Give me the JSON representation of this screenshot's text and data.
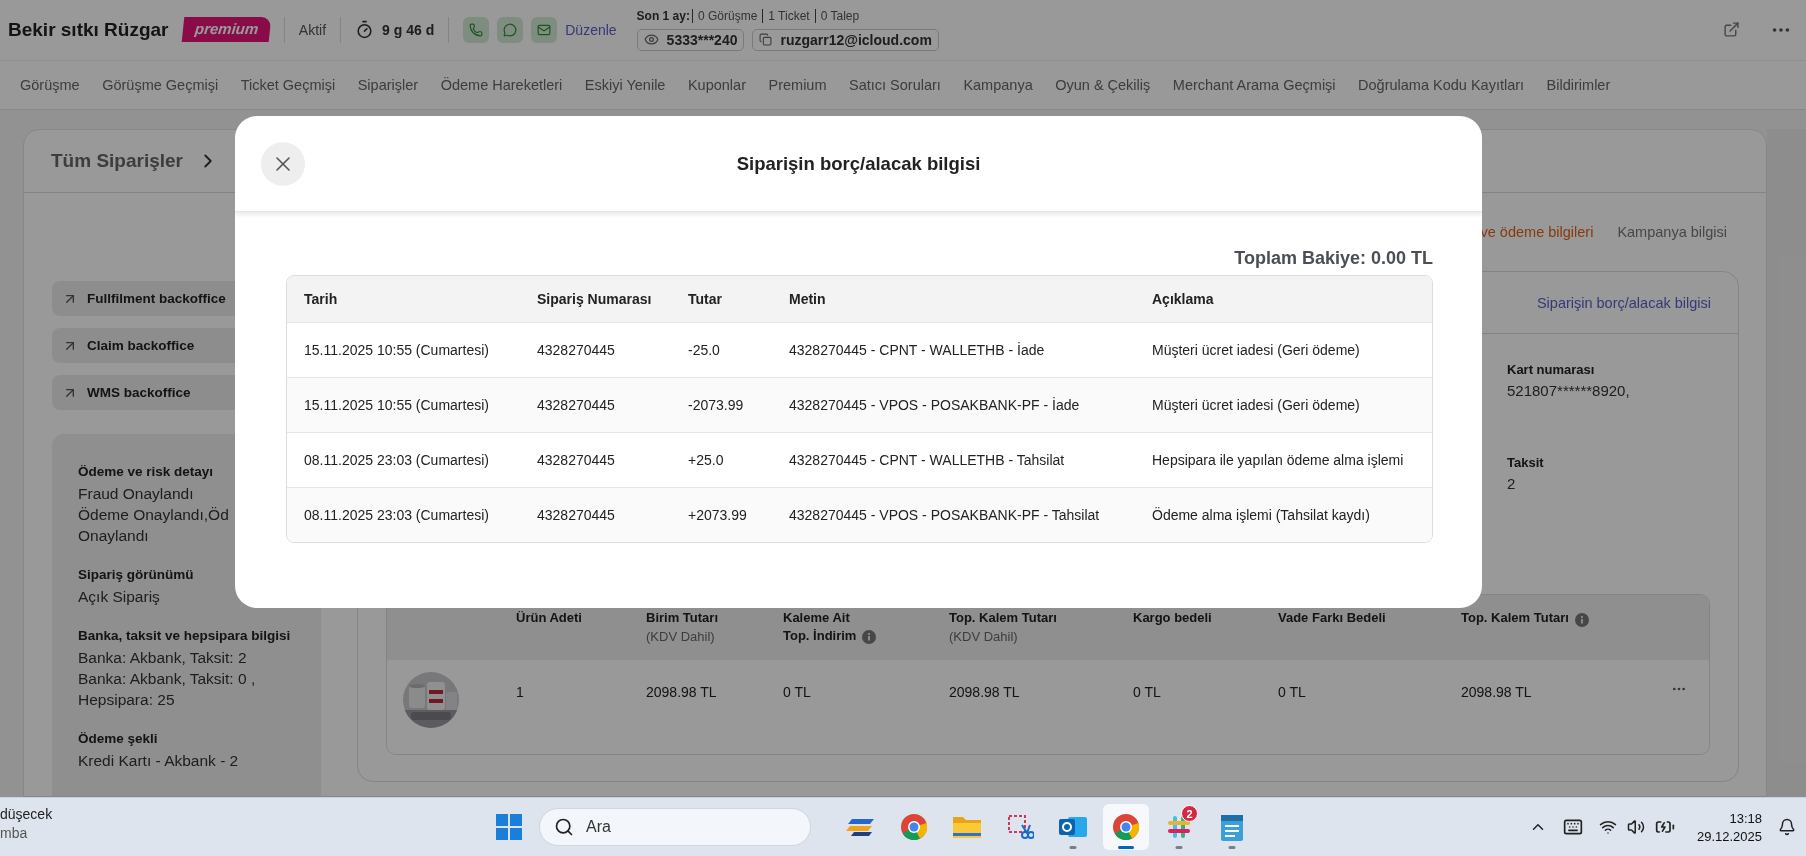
{
  "header": {
    "name": "Bekir sıtkı Rüzgar",
    "badge": "premium",
    "status": "Aktif",
    "duration": "9 g 46 d",
    "edit_link": "Düzenle",
    "stats_label": "Son 1 ay:",
    "stats": [
      "0 Görüşme",
      "1 Ticket",
      "0 Talep"
    ],
    "phone": "5333***240",
    "email": "ruzgarr12@icloud.com"
  },
  "nav_tabs": [
    "Görüşme",
    "Görüşme Geçmişi",
    "Ticket Geçmişi",
    "Siparişler",
    "Ödeme Hareketleri",
    "Eskiyi Yenile",
    "Kuponlar",
    "Premium",
    "Satıcı Soruları",
    "Kampanya",
    "Oyun & Çekiliş",
    "Merchant Arama Geçmişi",
    "Doğrulama Kodu Kayıtları",
    "Bildirimler"
  ],
  "breadcrumb": "Tüm Siparişler",
  "backoffice_links": [
    "Fullfilment backoffice",
    "Claim backoffice",
    "WMS backoffice"
  ],
  "details": [
    {
      "label": "Ödeme ve risk detayı",
      "lines": [
        "Fraud Onaylandı",
        "Ödeme Onaylandı,Öd",
        "Onaylandı"
      ]
    },
    {
      "label": "Sipariş görünümü",
      "lines": [
        "Açık Sipariş"
      ]
    },
    {
      "label": "Banka, taksit ve hepsipara bilgisi",
      "lines": [
        "Banka: Akbank, Taksit: 2",
        "Banka: Akbank, Taksit: 0 ,",
        "Hepsipara: 25"
      ]
    },
    {
      "label": "Ödeme şekli",
      "lines": [
        "Kredi Kartı - Akbank - 2"
      ]
    }
  ],
  "detail_tabs": [
    {
      "label": "ve ödeme bilgileri",
      "selected": true
    },
    {
      "label": "Kampanya bilgisi",
      "selected": false
    }
  ],
  "payment_card": {
    "link": "Siparişin borç/alacak bilgisi",
    "fields": [
      {
        "label": "Kart numarası",
        "value": "521807******8920,"
      },
      {
        "label": "Taksit",
        "value": "2"
      }
    ]
  },
  "items_table": {
    "columns": [
      {
        "lines": [
          "Ürün Adeti"
        ]
      },
      {
        "lines": [
          "Birim Tutarı"
        ],
        "sub": "(KDV Dahil)"
      },
      {
        "lines": [
          "Kaleme Ait",
          "Top. İndirim"
        ],
        "info": true
      },
      {
        "lines": [
          "Top. Kalem Tutarı"
        ],
        "sub": "(KDV Dahil)"
      },
      {
        "lines": [
          "Kargo bedeli"
        ]
      },
      {
        "lines": [
          "Vade Farkı Bedeli"
        ]
      },
      {
        "lines": [
          "Top. Kalem Tutarı"
        ],
        "info": true
      }
    ],
    "rows": [
      {
        "cells": [
          "1",
          "2098.98 TL",
          "0 TL",
          "2098.98 TL",
          "0 TL",
          "0 TL",
          "2098.98 TL"
        ]
      }
    ]
  },
  "modal": {
    "title": "Siparişin borç/alacak bilgisi",
    "total": "Toplam Bakiye: 0.00 TL",
    "columns": [
      "Tarih",
      "Sipariş Numarası",
      "Tutar",
      "Metin",
      "Açıklama"
    ],
    "rows": [
      [
        "15.11.2025 10:55 (Cumartesi)",
        "4328270445",
        "-25.0",
        "4328270445 - CPNT - WALLETHB - İade",
        "Müşteri ücret iadesi (Geri ödeme)"
      ],
      [
        "15.11.2025 10:55 (Cumartesi)",
        "4328270445",
        "-2073.99",
        "4328270445 - VPOS - POSAKBANK-PF - İade",
        "Müşteri ücret iadesi (Geri ödeme)"
      ],
      [
        "08.11.2025 23:03 (Cumartesi)",
        "4328270445",
        "+25.0",
        "4328270445 - CPNT - WALLETHB - Tahsilat",
        "Hepsipara ile yapılan ödeme alma işlemi"
      ],
      [
        "08.11.2025 23:03 (Cumartesi)",
        "4328270445",
        "+2073.99",
        "4328270445 - VPOS - POSAKBANK-PF - Tahsilat",
        "Ödeme alma işlemi (Tahsilat kaydı)"
      ]
    ]
  },
  "taskbar": {
    "weather": [
      "düşecek",
      "mba"
    ],
    "search_placeholder": "Ara",
    "apps": [
      {
        "kind": "stripes",
        "running": false,
        "selected": false
      },
      {
        "kind": "browser",
        "running": false,
        "selected": false
      },
      {
        "kind": "folder",
        "running": false,
        "selected": false
      },
      {
        "kind": "snip",
        "running": false,
        "selected": false
      },
      {
        "kind": "mail",
        "running": true,
        "selected": false
      },
      {
        "kind": "browser",
        "running": true,
        "selected": true
      },
      {
        "kind": "hash",
        "running": true,
        "selected": false,
        "badge": "2"
      },
      {
        "kind": "notepad",
        "running": true,
        "selected": false
      }
    ],
    "time": "13:18",
    "date": "29.12.2025"
  }
}
